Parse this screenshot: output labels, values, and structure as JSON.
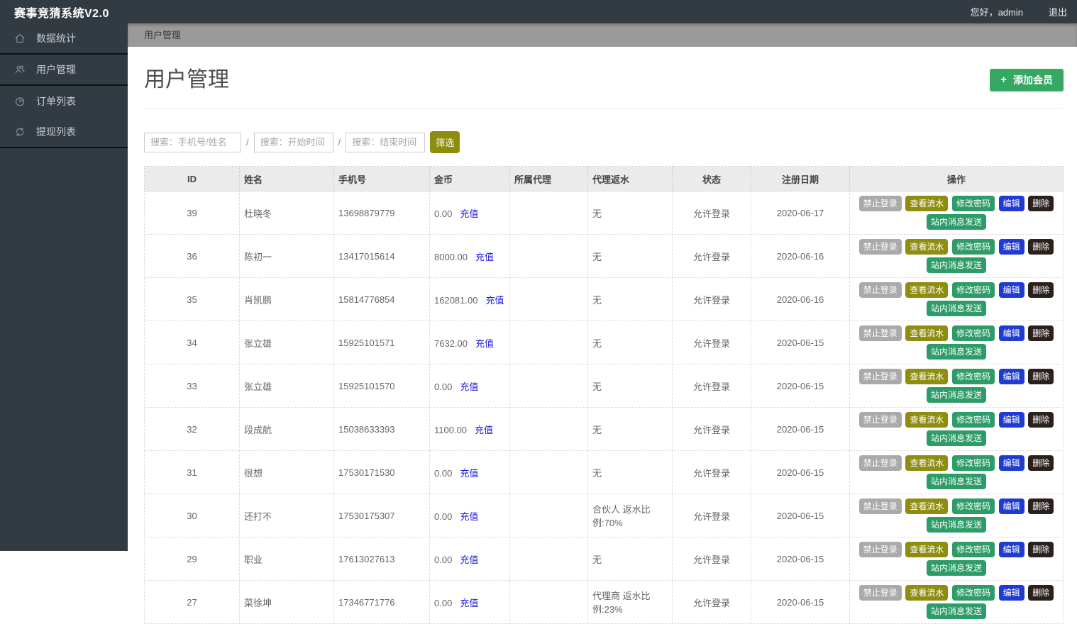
{
  "app": {
    "title": "赛事竞猜系统V2.0",
    "greeting": "您好，admin",
    "logout": "退出"
  },
  "sidebar": {
    "items": [
      {
        "label": "数据统计",
        "icon": "home-icon"
      },
      {
        "label": "用户管理",
        "icon": "users-icon"
      },
      {
        "label": "订单列表",
        "icon": "pie-chart-icon"
      },
      {
        "label": "提现列表",
        "icon": "refresh-icon"
      }
    ]
  },
  "breadcrumb": "用户管理",
  "page": {
    "title": "用户管理",
    "add_icon": "+",
    "add_button": "添加会员"
  },
  "search": {
    "name_placeholder": "搜索：手机号/姓名",
    "start_placeholder": "搜索：开始时间",
    "end_placeholder": "搜索：结束时间",
    "separator": "/",
    "filter_button": "筛选"
  },
  "table": {
    "headers": [
      "ID",
      "姓名",
      "手机号",
      "金币",
      "所属代理",
      "代理返水",
      "状态",
      "注册日期",
      "操作"
    ],
    "recharge_label": "充值",
    "actions": [
      {
        "name": "forbid-login",
        "label": "禁止登录",
        "color": "#aaaaaa"
      },
      {
        "name": "view-flow",
        "label": "查看流水",
        "color": "#8e8d10"
      },
      {
        "name": "change-password",
        "label": "修改密码",
        "color": "#2e9c68"
      },
      {
        "name": "edit",
        "label": "编辑",
        "color": "#1f3bd4"
      },
      {
        "name": "delete",
        "label": "删除",
        "color": "#2b201c"
      },
      {
        "name": "send-message",
        "label": "站内消息发送",
        "color": "#2e9c68"
      }
    ],
    "rows": [
      {
        "id": "39",
        "name": "杜晓冬",
        "phone": "13698879779",
        "coins": "0.00",
        "agent": "",
        "rebate": "无",
        "status": "允许登录",
        "date": "2020-06-17"
      },
      {
        "id": "36",
        "name": "陈初一",
        "phone": "13417015614",
        "coins": "8000.00",
        "agent": "",
        "rebate": "无",
        "status": "允许登录",
        "date": "2020-06-16"
      },
      {
        "id": "35",
        "name": "肖凯鹏",
        "phone": "15814776854",
        "coins": "162081.00",
        "agent": "",
        "rebate": "无",
        "status": "允许登录",
        "date": "2020-06-16"
      },
      {
        "id": "34",
        "name": "张立雄",
        "phone": "15925101571",
        "coins": "7632.00",
        "agent": "",
        "rebate": "无",
        "status": "允许登录",
        "date": "2020-06-15"
      },
      {
        "id": "33",
        "name": "张立雄",
        "phone": "15925101570",
        "coins": "0.00",
        "agent": "",
        "rebate": "无",
        "status": "允许登录",
        "date": "2020-06-15"
      },
      {
        "id": "32",
        "name": "段成航",
        "phone": "15038633393",
        "coins": "1100.00",
        "agent": "",
        "rebate": "无",
        "status": "允许登录",
        "date": "2020-06-15"
      },
      {
        "id": "31",
        "name": "很想",
        "phone": "17530171530",
        "coins": "0.00",
        "agent": "",
        "rebate": "无",
        "status": "允许登录",
        "date": "2020-06-15"
      },
      {
        "id": "30",
        "name": "还打不",
        "phone": "17530175307",
        "coins": "0.00",
        "agent": "",
        "rebate": "合伙人 返水比例:70%",
        "status": "允许登录",
        "date": "2020-06-15"
      },
      {
        "id": "29",
        "name": "职业",
        "phone": "17613027613",
        "coins": "0.00",
        "agent": "",
        "rebate": "无",
        "status": "允许登录",
        "date": "2020-06-15"
      },
      {
        "id": "27",
        "name": "菜徐坤",
        "phone": "17346771776",
        "coins": "0.00",
        "agent": "",
        "rebate": "代理商 返水比例:23%",
        "status": "允许登录",
        "date": "2020-06-15"
      }
    ]
  },
  "theme": {
    "header_bg": "#333b42",
    "sidebar_bg": "#333b42",
    "breadcrumb_bg": "#9a9a9a",
    "add_button_green": "#35a862",
    "filter_olive": "#8e8d10",
    "link_blue": "#1a1ae0",
    "table_header_bg": "#ebebeb"
  }
}
